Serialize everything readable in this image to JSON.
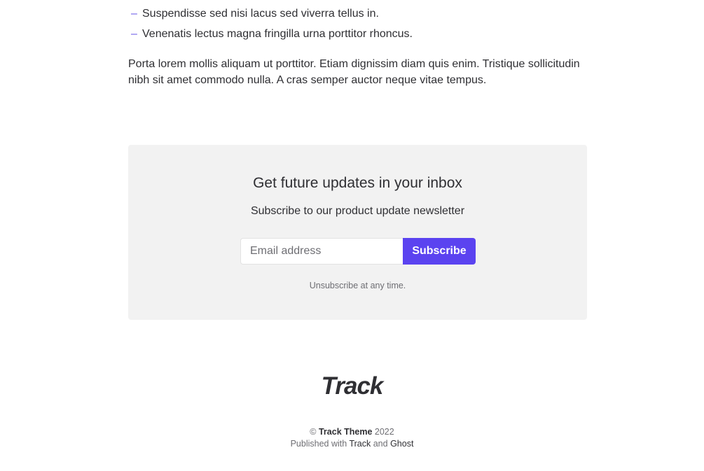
{
  "article": {
    "bullets": [
      "Suspendisse sed nisi lacus sed viverra tellus in.",
      "Venenatis lectus magna fringilla urna porttitor rhoncus."
    ],
    "bullet_marker": "–",
    "paragraph": "Porta lorem mollis aliquam ut porttitor. Etiam dignissim diam quis enim. Tristique sollicitudin nibh sit amet commodo nulla. A cras semper auctor neque vitae tempus."
  },
  "subscribe": {
    "title": "Get future updates in your inbox",
    "description": "Subscribe to our product update newsletter",
    "email_placeholder": "Email address",
    "email_value": "",
    "button_label": "Subscribe",
    "note": "Unsubscribe at any time."
  },
  "footer": {
    "logo_text": "Track",
    "copyright_symbol": "©",
    "site_name": "Track Theme",
    "year": "2022",
    "published_with": "Published with",
    "track_link": "Track",
    "and": "and",
    "ghost_link": "Ghost"
  },
  "colors": {
    "accent": "#5b43f0",
    "text": "#2f2f33",
    "muted": "#6e6e73",
    "box_bg": "#f2f2f2"
  }
}
